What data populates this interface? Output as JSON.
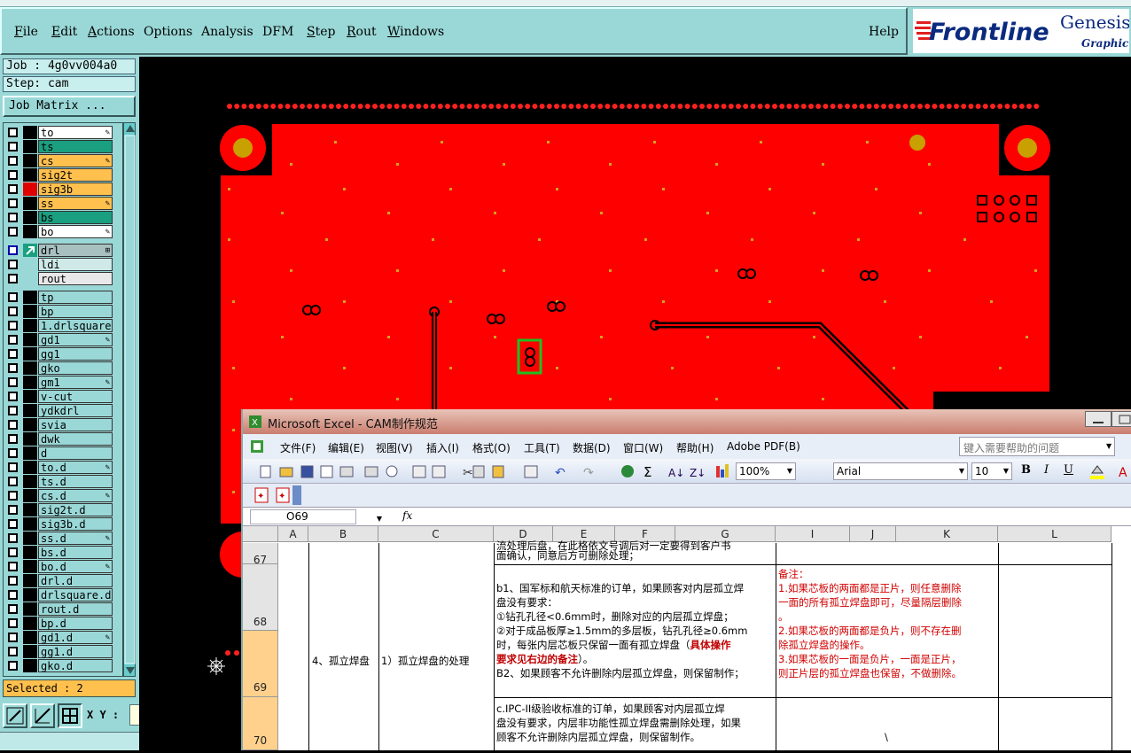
{
  "menu": {
    "items": [
      {
        "label": "File",
        "u": "F",
        "rest": "ile"
      },
      {
        "label": "Edit",
        "u": "E",
        "rest": "dit"
      },
      {
        "label": "Actions",
        "u": "A",
        "rest": "ctions"
      },
      {
        "label": "Options",
        "u": "",
        "rest": "Options"
      },
      {
        "label": "Analysis",
        "u": "",
        "rest": "Analysis"
      },
      {
        "label": "DFM",
        "u": "",
        "rest": "DFM"
      },
      {
        "label": "Step",
        "u": "S",
        "rest": "tep"
      },
      {
        "label": "Rout",
        "u": "R",
        "rest": "out"
      },
      {
        "label": "Windows",
        "u": "W",
        "rest": "indows"
      }
    ],
    "help": "Help"
  },
  "logo": {
    "brand": "Frontline",
    "product": "Genesis",
    "tagline": "Graphic E"
  },
  "job": {
    "job_line": "Job : 4g0vv004a0",
    "step_line": "Step: cam",
    "matrix_button": "Job Matrix ..."
  },
  "layers": [
    {
      "name": "to",
      "color": "#ffffff",
      "swatch": "#000000",
      "mark": "✎"
    },
    {
      "name": "ts",
      "color": "#1aa080",
      "swatch": "#000000",
      "mark": ""
    },
    {
      "name": "cs",
      "color": "#ffc04d",
      "swatch": "#000000",
      "mark": "✎"
    },
    {
      "name": "sig2t",
      "color": "#ffc04d",
      "swatch": "#000000",
      "mark": ""
    },
    {
      "name": "sig3b",
      "color": "#ffc04d",
      "swatch": "#e00000",
      "mark": ""
    },
    {
      "name": "ss",
      "color": "#ffc04d",
      "swatch": "#000000",
      "mark": "✎"
    },
    {
      "name": "bs",
      "color": "#1aa080",
      "swatch": "#000000",
      "mark": ""
    },
    {
      "name": "bo",
      "color": "#ffffff",
      "swatch": "#000000",
      "mark": "✎"
    },
    {
      "name": "drl",
      "color": "#a8c0c0",
      "swatch": "#1aa080",
      "mark": "⊞",
      "active": true
    },
    {
      "name": "ldi",
      "color": "#cfe8e8",
      "swatch": "#9ad8d8",
      "mark": ""
    },
    {
      "name": "rout",
      "color": "#e8e8e8",
      "swatch": "#9ad8d8",
      "mark": ""
    },
    {
      "name": "tp",
      "color": "#9ad8d8",
      "swatch": "#000000",
      "mark": ""
    },
    {
      "name": "bp",
      "color": "#9ad8d8",
      "swatch": "#000000",
      "mark": ""
    },
    {
      "name": "1.drlsquare",
      "color": "#9ad8d8",
      "swatch": "#000000",
      "mark": ""
    },
    {
      "name": "gd1",
      "color": "#9ad8d8",
      "swatch": "#000000",
      "mark": "✎"
    },
    {
      "name": "gg1",
      "color": "#9ad8d8",
      "swatch": "#000000",
      "mark": ""
    },
    {
      "name": "gko",
      "color": "#9ad8d8",
      "swatch": "#000000",
      "mark": ""
    },
    {
      "name": "gm1",
      "color": "#9ad8d8",
      "swatch": "#000000",
      "mark": "✎"
    },
    {
      "name": "v-cut",
      "color": "#9ad8d8",
      "swatch": "#000000",
      "mark": ""
    },
    {
      "name": "ydkdrl",
      "color": "#9ad8d8",
      "swatch": "#000000",
      "mark": ""
    },
    {
      "name": "svia",
      "color": "#9ad8d8",
      "swatch": "#000000",
      "mark": ""
    },
    {
      "name": "dwk",
      "color": "#9ad8d8",
      "swatch": "#000000",
      "mark": ""
    },
    {
      "name": "d",
      "color": "#9ad8d8",
      "swatch": "#000000",
      "mark": ""
    },
    {
      "name": "to.d",
      "color": "#9ad8d8",
      "swatch": "#000000",
      "mark": "✎"
    },
    {
      "name": "ts.d",
      "color": "#9ad8d8",
      "swatch": "#000000",
      "mark": ""
    },
    {
      "name": "cs.d",
      "color": "#9ad8d8",
      "swatch": "#000000",
      "mark": "✎"
    },
    {
      "name": "sig2t.d",
      "color": "#9ad8d8",
      "swatch": "#000000",
      "mark": ""
    },
    {
      "name": "sig3b.d",
      "color": "#9ad8d8",
      "swatch": "#000000",
      "mark": ""
    },
    {
      "name": "ss.d",
      "color": "#9ad8d8",
      "swatch": "#000000",
      "mark": "✎"
    },
    {
      "name": "bs.d",
      "color": "#9ad8d8",
      "swatch": "#000000",
      "mark": ""
    },
    {
      "name": "bo.d",
      "color": "#9ad8d8",
      "swatch": "#000000",
      "mark": "✎"
    },
    {
      "name": "drl.d",
      "color": "#9ad8d8",
      "swatch": "#000000",
      "mark": ""
    },
    {
      "name": "drlsquare.d",
      "color": "#9ad8d8",
      "swatch": "#000000",
      "mark": ""
    },
    {
      "name": "rout.d",
      "color": "#9ad8d8",
      "swatch": "#000000",
      "mark": ""
    },
    {
      "name": "bp.d",
      "color": "#9ad8d8",
      "swatch": "#000000",
      "mark": ""
    },
    {
      "name": "gd1.d",
      "color": "#9ad8d8",
      "swatch": "#000000",
      "mark": "✎"
    },
    {
      "name": "gg1.d",
      "color": "#9ad8d8",
      "swatch": "#000000",
      "mark": ""
    },
    {
      "name": "gko.d",
      "color": "#9ad8d8",
      "swatch": "#000000",
      "mark": ""
    }
  ],
  "status": {
    "selected": "Selected : 2",
    "xy_label": "X Y :"
  },
  "excel": {
    "title": "Microsoft Excel - CAM制作规范",
    "menu": [
      "文件(F)",
      "编辑(E)",
      "视图(V)",
      "插入(I)",
      "格式(O)",
      "工具(T)",
      "数据(D)",
      "窗口(W)",
      "帮助(H)",
      "Adobe PDF(B)"
    ],
    "help_placeholder": "键入需要帮助的问题",
    "zoom": "100%",
    "font": "Arial",
    "font_size": "10",
    "bold": "B",
    "italic": "I",
    "underline": "U",
    "name_box": "O69",
    "fx": "fx",
    "columns": [
      "A",
      "B",
      "C",
      "D",
      "E",
      "F",
      "G",
      "I",
      "J",
      "K",
      "L"
    ],
    "rows": [
      "67",
      "68",
      "69",
      "70"
    ],
    "cells": {
      "d67_top": "流处理后盘，在此格依文号调后对一定要得到客户书",
      "d67": "面确认，同意后方可删除处理；",
      "b69": "4、孤立焊盘",
      "c69": "1）孤立焊盘的处理",
      "d68_1": "b1、国军标和航天标准的订单，如果顾客对内层孤立焊",
      "d68_2": "盘没有要求：",
      "d68_3": "①钻孔孔径<0.6mm时，删除对应的内层孤立焊盘；",
      "d68_4": "②对于成品板厚≥1.5mm的多层板，钻孔孔径≥0.6mm",
      "d68_5a": "时，每张内层芯板只保留一面有孤立焊盘（",
      "d68_5b": "具体操作",
      "d68_6a": "要求见右边的备注",
      "d68_6b": "）。",
      "d68_7": "B2、如果顾客不允许删除内层孤立焊盘，则保留制作；",
      "i68_1": "备注：",
      "i68_2": "1.如果芯板的两面都是正片，则任意删除",
      "i68_3": "一面的所有孤立焊盘即可，尽量隔层删除",
      "i68_4": "。",
      "i68_5": "2.如果芯板的两面都是负片，则不存在删",
      "i68_6": "除孤立焊盘的操作。",
      "i68_7": "3.如果芯板的一面是负片，一面是正片，",
      "i68_8": "则正片层的孤立焊盘也保留，不做删除。",
      "d70_1": "c.IPC-II级验收标准的订单，如果顾客对内层孤立焊",
      "d70_2": "盘没有要求，内层非功能性孤立焊盘需删除处理，如果",
      "d70_3": "顾客不允许删除内层孤立焊盘，则保留制作。",
      "i70": "\\"
    }
  }
}
